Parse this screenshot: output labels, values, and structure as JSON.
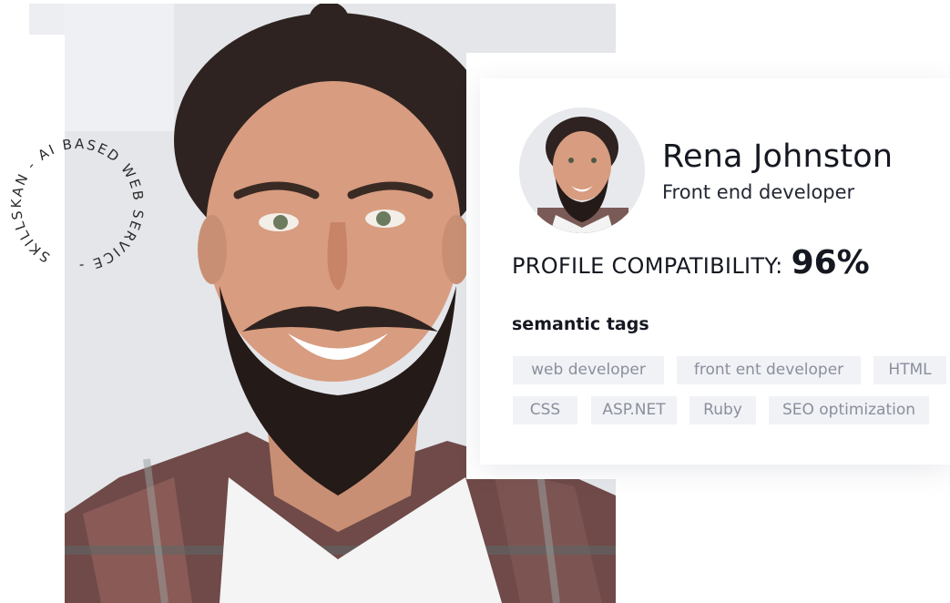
{
  "badge": {
    "circular_text": "SKILLSKAN - AI BASED WEB SERVICE - "
  },
  "profile": {
    "name": "Rena Johnston",
    "role": "Front end developer",
    "compatibility_label": "PROFILE COMPATIBILITY:",
    "compatibility_value": "96%"
  },
  "tags": {
    "title": "semantic tags",
    "items": [
      "web developer",
      "front ent developer",
      "HTML",
      "CSS",
      "ASP.NET",
      "Ruby",
      "SEO optimization"
    ]
  },
  "colors": {
    "tag_bg": "#f1f2f6",
    "tag_text": "#8a8f9c",
    "text": "#151821"
  }
}
